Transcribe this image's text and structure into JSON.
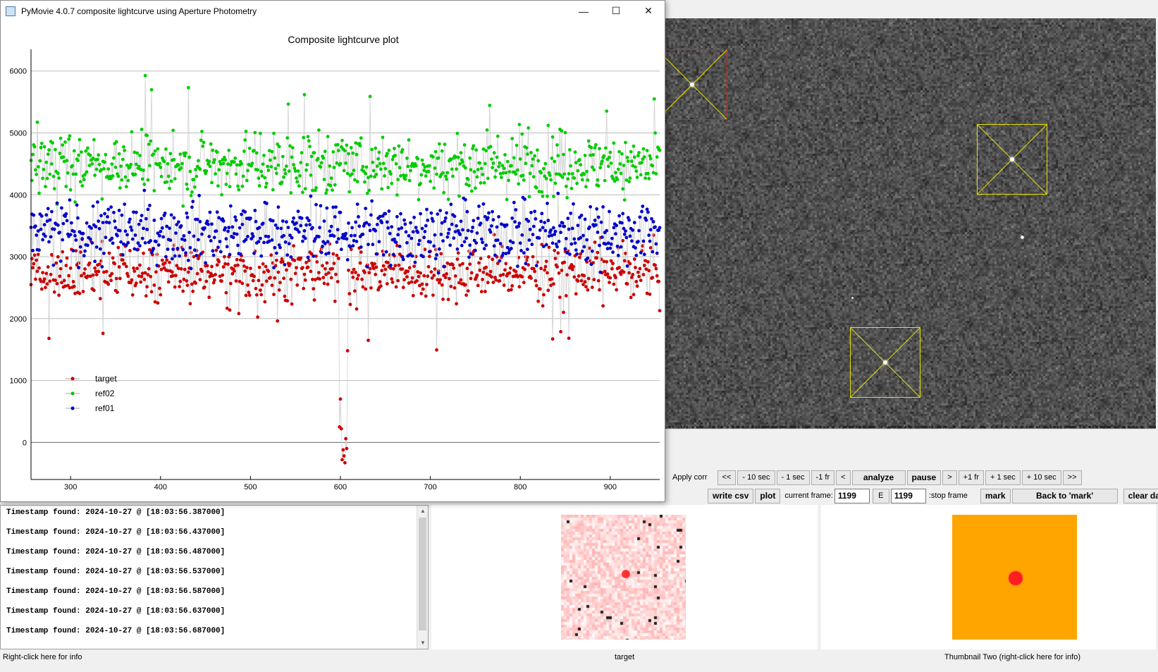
{
  "window": {
    "title": "PyMovie 4.0.7 composite lightcurve using Aperture Photometry",
    "minimize_glyph": "—",
    "maximize_glyph": "☐",
    "close_glyph": "✕"
  },
  "chart_data": {
    "type": "scatter",
    "title": "Composite lightcurve plot",
    "xlabel": "",
    "ylabel": "",
    "xlim": [
      256,
      955
    ],
    "ylim": [
      -600,
      6350
    ],
    "x_ticks": [
      300,
      400,
      500,
      600,
      700,
      800,
      900
    ],
    "y_ticks": [
      0,
      1000,
      2000,
      3000,
      4000,
      5000,
      6000
    ],
    "grid": "horizontal",
    "legend_position": "bottom-left",
    "series": [
      {
        "name": "target",
        "color": "#cc0000",
        "mean": 2750,
        "spread": 380,
        "events": [
          {
            "x": 599,
            "value": 250
          },
          {
            "x": 600,
            "value": 700
          },
          {
            "x": 601,
            "value": 220
          },
          {
            "x": 602,
            "value": -280
          },
          {
            "x": 603,
            "value": -120
          },
          {
            "x": 604,
            "value": -220
          },
          {
            "x": 605,
            "value": -330
          },
          {
            "x": 606,
            "value": 60
          },
          {
            "x": 607,
            "value": -100
          },
          {
            "x": 608,
            "value": 1480
          }
        ]
      },
      {
        "name": "ref02",
        "color": "#00cc00",
        "mean": 4500,
        "spread": 420,
        "events": []
      },
      {
        "name": "ref01",
        "color": "#0000cc",
        "mean": 3400,
        "spread": 420,
        "events": []
      }
    ],
    "x_range_data": [
      256,
      955
    ]
  },
  "controls": {
    "apply_corr_label": "Apply corr",
    "nav_buttons": [
      "<<",
      "- 10 sec",
      "- 1 sec",
      "-1 fr",
      "<",
      "analyze",
      "pause",
      ">",
      "+1 fr",
      "+ 1 sec",
      "+ 10 sec",
      ">>"
    ],
    "write_csv": "write csv",
    "plot": "plot",
    "current_frame_label": "current frame:",
    "current_frame": "1199",
    "e_button": "E",
    "stop_frame_value": "1199",
    "stop_frame_label": ":stop frame",
    "mark": "mark",
    "back_to_mark": "Back to 'mark'",
    "clear_data": "clear data"
  },
  "log": {
    "lines": [
      "Timestamp found: 2024-10-27 @ [18:03:56.387000]",
      "Timestamp found: 2024-10-27 @ [18:03:56.437000]",
      "Timestamp found: 2024-10-27 @ [18:03:56.487000]",
      "Timestamp found: 2024-10-27 @ [18:03:56.537000]",
      "Timestamp found: 2024-10-27 @ [18:03:56.587000]",
      "Timestamp found: 2024-10-27 @ [18:03:56.637000]",
      "Timestamp found: 2024-10-27 @ [18:03:56.687000]"
    ],
    "scroll_up": "▲",
    "scroll_down": "▼"
  },
  "captions": {
    "left": "Right-click here for info",
    "center": "target",
    "right": "Thumbnail Two (right-click here for info)"
  },
  "colors": {
    "thumbnail_two_bg": "#ffa500",
    "aperture_target": "#d8241c",
    "aperture_ref": "#e8e000"
  }
}
